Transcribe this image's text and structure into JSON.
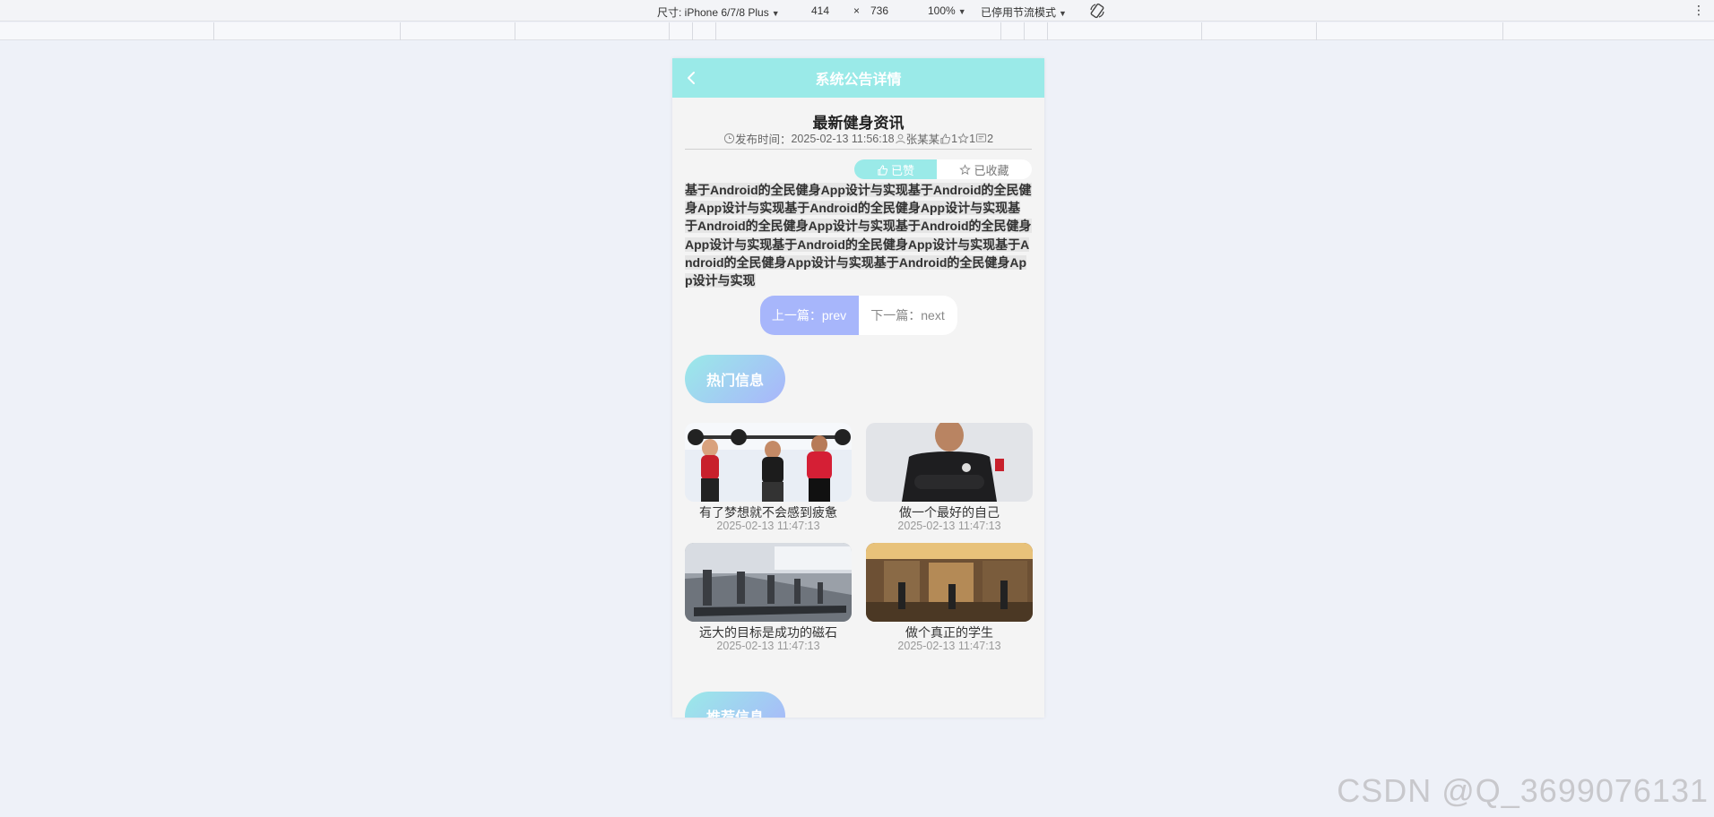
{
  "devtools": {
    "device_label": "尺寸: iPhone 6/7/8 Plus",
    "width": "414",
    "times": "×",
    "height": "736",
    "zoom": "100%",
    "throttle": "已停用节流模式"
  },
  "navbar": {
    "title": "系统公告详情"
  },
  "article": {
    "title": "最新健身资讯",
    "publish_label": "发布时间：",
    "publish_time": "2025-02-13 11:56:18",
    "author": "张某某",
    "likes": "1",
    "favorites": "1",
    "comments": "2",
    "like_label": "已赞",
    "fav_label": "已收藏",
    "content": "基于Android的全民健身App设计与实现基于Android的全民健身App设计与实现基于Android的全民健身App设计与实现基于Android的全民健身App设计与实现基于Android的全民健身App设计与实现基于Android的全民健身App设计与实现基于Android的全民健身App设计与实现基于Android的全民健身App设计与实现"
  },
  "pager": {
    "prev": "上一篇：prev",
    "next": "下一篇：next"
  },
  "hot": {
    "title": "热门信息",
    "items": [
      {
        "name": "有了梦想就不会感到疲惫",
        "time": "2025-02-13 11:47:13",
        "image": "gym-training-photo"
      },
      {
        "name": "做一个最好的自己",
        "time": "2025-02-13 11:47:13",
        "image": "trainer-portrait-photo"
      },
      {
        "name": "远大的目标是成功的磁石",
        "time": "2025-02-13 11:47:13",
        "image": "treadmill-row-photo"
      },
      {
        "name": "做个真正的学生",
        "time": "2025-02-13 11:47:13",
        "image": "gym-interior-photo"
      }
    ]
  },
  "recommend": {
    "title": "推荐信息"
  },
  "watermark": "CSDN @Q_3699076131"
}
